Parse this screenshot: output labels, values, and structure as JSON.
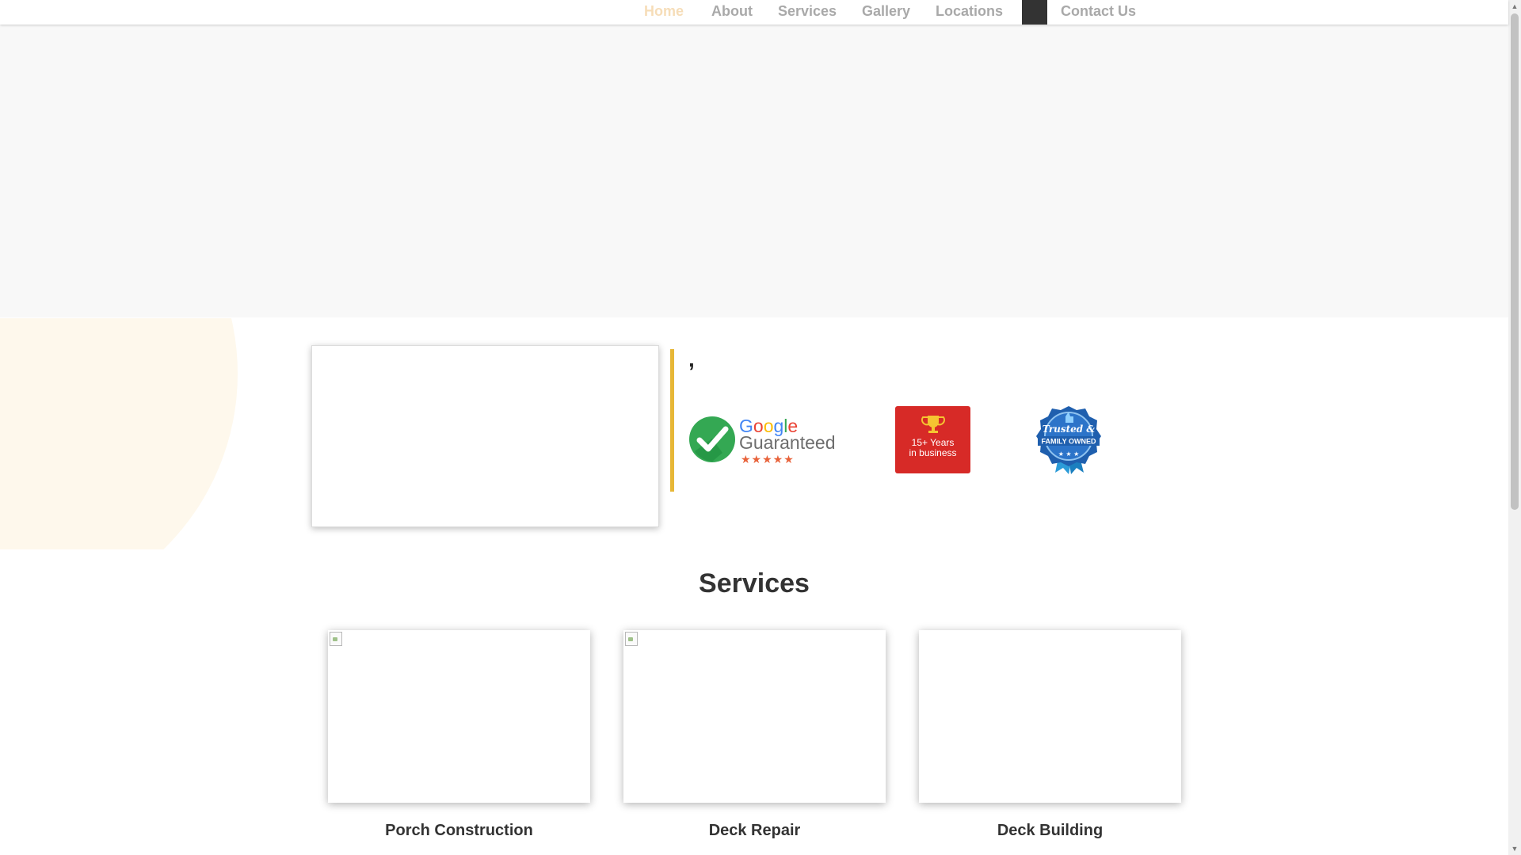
{
  "nav": {
    "items": [
      {
        "label": "Home",
        "active": true
      },
      {
        "label": "About"
      },
      {
        "label": "Services"
      },
      {
        "label": "Gallery"
      },
      {
        "label": "Locations"
      },
      {
        "label": "Contact Us"
      }
    ]
  },
  "about": {
    "comma": ",",
    "badges": {
      "google": {
        "word1": "Google",
        "word2": "Guaranteed",
        "stars": "★★★★★"
      },
      "years": {
        "line1": "15+ Years",
        "line2": "in business"
      },
      "family": {
        "line1": "Trusted &",
        "line2": "FAMILY OWNED",
        "stars": "★ ★ ★"
      }
    }
  },
  "services": {
    "title": "Services",
    "cards": [
      {
        "label": "Porch Construction",
        "image": "broken"
      },
      {
        "label": "Deck Repair",
        "image": "broken"
      },
      {
        "label": "Deck Building",
        "image": "blank"
      }
    ]
  },
  "colors": {
    "accent_gold": "#e7b737",
    "hero_bg": "#f8f8f8",
    "blob_bg": "#fef8ec",
    "badge_red": "#d72a27",
    "badge_blue": "#1f5fae",
    "google_green": "#34a853",
    "star_orange": "#e8623a"
  },
  "icons": [
    "check-circle-icon",
    "trophy-icon",
    "thumbs-up-icon",
    "ribbon-icon",
    "broken-image-icon"
  ]
}
